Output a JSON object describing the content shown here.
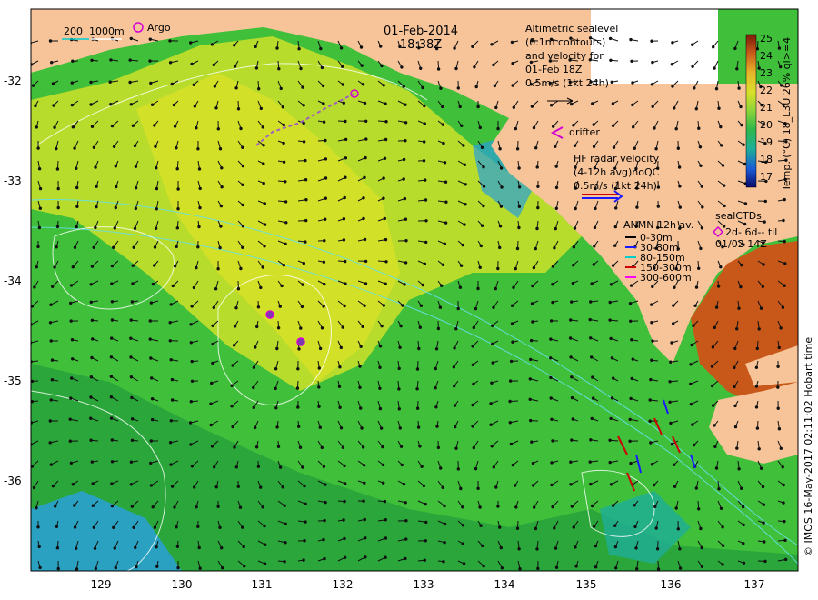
{
  "title": {
    "date": "01-Feb-2014",
    "time": "18:38Z"
  },
  "map": {
    "lon_range": [
      128.2,
      137.5
    ],
    "lat_range": [
      -36.9,
      -31.2
    ],
    "lon_ticks": [
      "129",
      "130",
      "131",
      "132",
      "133",
      "134",
      "135",
      "136",
      "137"
    ],
    "lat_ticks": [
      "-32",
      "-33",
      "-34",
      "-35",
      "-36"
    ],
    "colors": {
      "land": "#f7c49a",
      "ocean_mid": "#3fbf3a",
      "warm": "#c8581a",
      "cool": "#2aa0d8"
    }
  },
  "legend": {
    "depth_contours": {
      "label_a": "200",
      "label_b": "1000m"
    },
    "argo": {
      "label": "Argo",
      "color": "#d400d4"
    },
    "altimetry": {
      "line1": "Altimetric sealevel",
      "line2": "(0.1m contours)",
      "line3": "and velocity for",
      "line4": "01-Feb 18Z",
      "line5": "0.5m/s (1kt 24h)"
    },
    "drifter": {
      "label": "drifter",
      "color": "#d400d4"
    },
    "hf_radar": {
      "line1": "HF radar velocity",
      "line2": "(4-12h avg)noQC",
      "line3": "0.5m/s (1kt 24h)"
    },
    "anmn": {
      "title": "ANMN 12h av.",
      "items": [
        {
          "label": "0-30m",
          "color": "#000000"
        },
        {
          "label": "30-80m",
          "color": "#1a1aff"
        },
        {
          "label": "80-150m",
          "color": "#00cccc"
        },
        {
          "label": "150-300m",
          "color": "#cc0000"
        },
        {
          "label": "300-600m",
          "color": "#ff00ff"
        }
      ]
    },
    "seal_ctds": {
      "title": "sealCTDs",
      "line2": "2d- 6d-- til",
      "line3": "01/02 14Z",
      "color": "#d400d4"
    }
  },
  "colorbar": {
    "ticks": [
      "25",
      "24",
      "23",
      "22",
      "21",
      "20",
      "19",
      "18",
      "17"
    ],
    "label": "Temp. (°C) 18_L3U 26% ql>=4"
  },
  "credit": "© IMOS 16-May-2017 02:11:02 Hobart time"
}
